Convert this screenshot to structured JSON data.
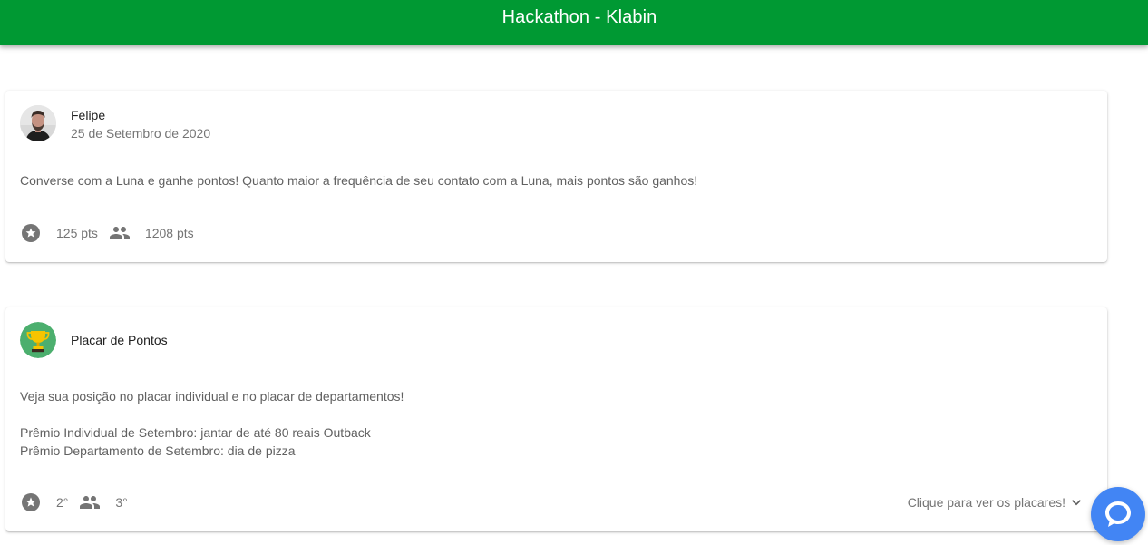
{
  "appbar": {
    "title": "Hackathon - Klabin",
    "color": "#009933"
  },
  "posts": [
    {
      "author": "Felipe",
      "date": "25 de Setembro de 2020",
      "avatar_icon": "user-photo-avatar",
      "text": "Converse com a Luna e ganhe pontos! Quanto maior a frequência de seu contato com a Luna, mais pontos são ganhos!",
      "individual_icon": "star-icon",
      "individual_value": "125 pts",
      "group_icon": "people-icon",
      "group_value": "1208 pts"
    },
    {
      "author": "Placar de Pontos",
      "avatar_icon": "trophy-icon",
      "text_lines": [
        "Veja sua posição no placar individual e no placar de departamentos!",
        "Prêmio Individual de Setembro: jantar de até 80 reais Outback",
        "Prêmio Departamento de Setembro: dia de pizza"
      ],
      "individual_icon": "star-icon",
      "individual_value": "2°",
      "group_icon": "people-icon",
      "group_value": "3°",
      "expand_label": "Clique para ver os placares!",
      "expand_icon": "chevron-down-icon"
    }
  ],
  "chat": {
    "icon": "chat-bubble-icon",
    "color": "#4285f4"
  }
}
